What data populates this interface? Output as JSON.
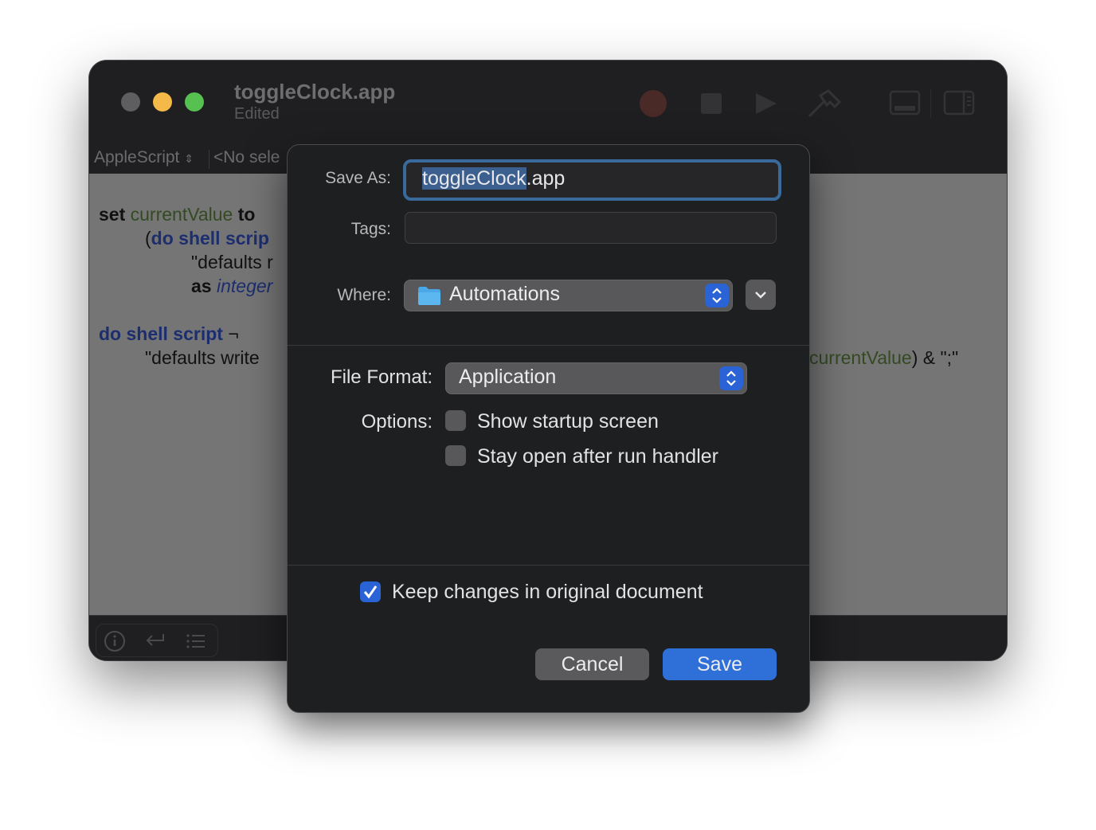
{
  "window": {
    "title": "toggleClock.app",
    "subtitle": "Edited",
    "traffic_lights": {
      "close": "#5e5e60",
      "minimize": "#f5b94a",
      "maximize": "#56c150"
    },
    "toolbar_icons": [
      "record-icon",
      "stop-icon",
      "run-icon",
      "compile-hammer-icon",
      "show-log-icon",
      "show-sidebar-icon"
    ],
    "navbar": {
      "language": "AppleScript",
      "language_chevron": "⌃⌄",
      "selection": "<No sele"
    },
    "code": {
      "line1": {
        "kw": "set",
        "var": "currentValue",
        "rest": "to"
      },
      "line2": {
        "paren": "(",
        "cmd": "do shell scrip"
      },
      "line3": {
        "text": "\"defaults r"
      },
      "line4": {
        "kw": "as",
        "cls": "integer"
      },
      "line5": {
        "cmd": "do shell script",
        "cont": "¬"
      },
      "line6": {
        "text": "\"defaults write"
      },
      "line6_tail": {
        "var": "currentValue",
        "rest": ") & \";\""
      }
    },
    "bottom_icons": [
      "info-icon",
      "return-icon",
      "list-icon"
    ]
  },
  "dialog": {
    "save_as_label": "Save As:",
    "save_as_selected": "toggleClock",
    "save_as_rest": ".app",
    "tags_label": "Tags:",
    "tags_value": "",
    "where_label": "Where:",
    "where_value": "Automations",
    "file_format_label": "File Format:",
    "file_format_value": "Application",
    "options_label": "Options:",
    "options": [
      {
        "label": "Show startup screen",
        "checked": false
      },
      {
        "label": "Stay open after run handler",
        "checked": false
      }
    ],
    "keep_changes": {
      "label": "Keep changes in original document",
      "checked": true
    },
    "cancel_label": "Cancel",
    "save_label": "Save",
    "accent_color": "#2e6fd8"
  }
}
